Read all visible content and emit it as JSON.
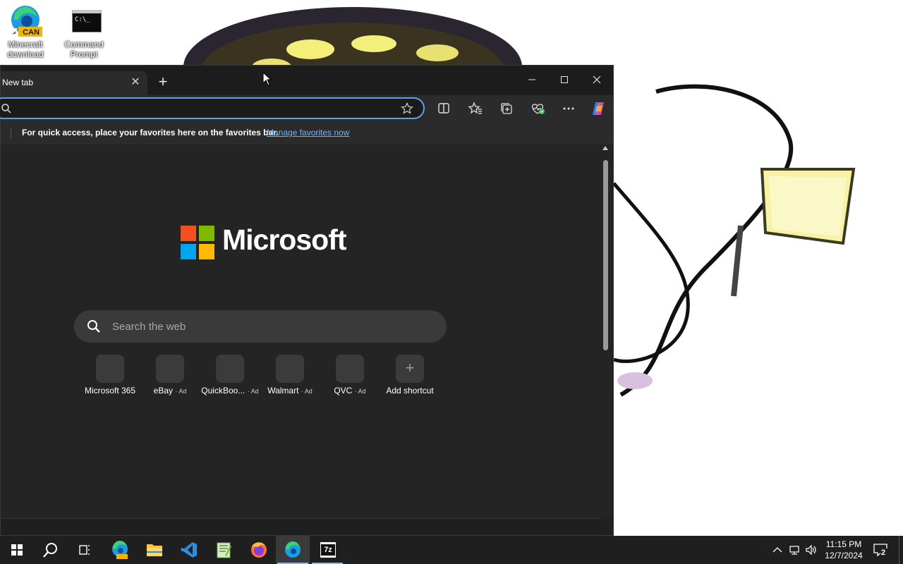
{
  "desktop": {
    "icons": [
      {
        "label": "Minecraft download",
        "badge": "CAN",
        "icon": "edge-can-icon"
      },
      {
        "label": "Command Prompt",
        "icon_text": "C:\\_",
        "icon": "command-prompt-icon"
      }
    ]
  },
  "browser": {
    "tab_title": "New tab",
    "address_value": "",
    "favorites_bar": {
      "text": "For quick access, place your favorites here on the favorites bar.",
      "link": "Manage favorites now"
    },
    "brand": "Microsoft",
    "search_placeholder": "Search the web",
    "shortcuts": [
      {
        "label": "Microsoft 365",
        "ad": ""
      },
      {
        "label": "eBay",
        "ad": "· Ad"
      },
      {
        "label": "QuickBoo...",
        "ad": "· Ad"
      },
      {
        "label": "Walmart",
        "ad": "· Ad"
      },
      {
        "label": "QVC",
        "ad": "· Ad"
      },
      {
        "label": "Add shortcut",
        "ad": "",
        "symbol": "+"
      }
    ],
    "colors": {
      "accent": "#5aa0ea",
      "link": "#6cb6ff",
      "background": "#242424"
    }
  },
  "taskbar": {
    "apps": [
      "start",
      "search",
      "task-view",
      "edge-can",
      "file-explorer",
      "vs-code",
      "notepad-plus",
      "firefox",
      "edge",
      "7zip"
    ],
    "clock_time": "11:15 PM",
    "clock_date": "12/7/2024",
    "notification_count": "2",
    "sevenzip_label": "7z"
  }
}
